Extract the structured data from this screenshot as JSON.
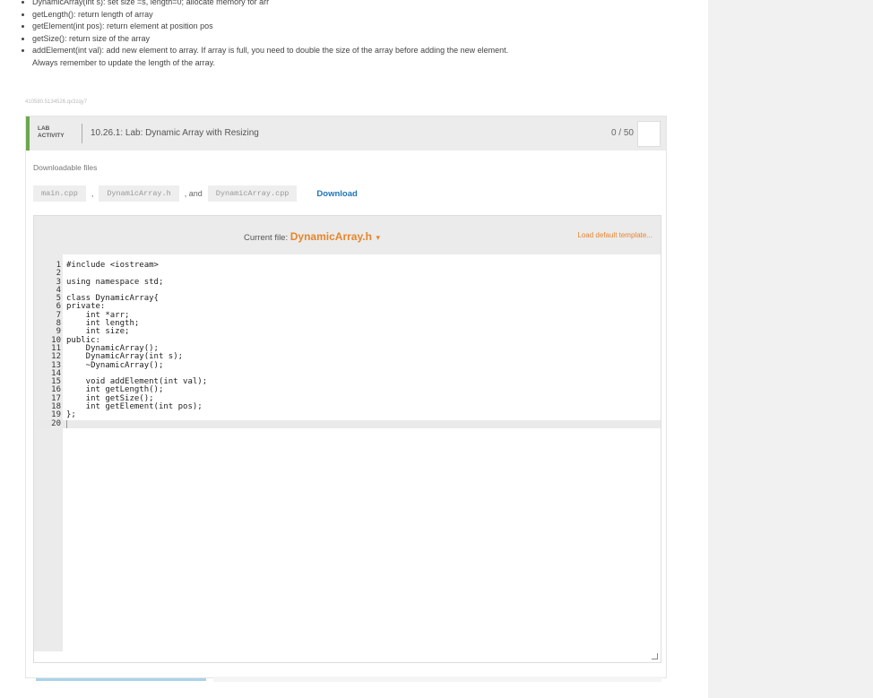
{
  "instructions": {
    "bullets": [
      "DynamicArray(int s): set size =s, length=0; allocate memory for arr",
      "getLength(): return length of array",
      "getElement(int pos): return element at position pos",
      "getSize(): return size of the array",
      "addElement(int val): add new element to array. If array is full, you need to double the size of the array before adding the new element."
    ],
    "bullet_continuation": "Always remember to update the length of the array."
  },
  "activity_id": "410580.5134526.qx3zqy7",
  "lab": {
    "tag_line1": "LAB",
    "tag_line2": "ACTIVITY",
    "title": "10.26.1: Lab: Dynamic Array with Resizing",
    "score": "0 / 50"
  },
  "downloads": {
    "label": "Downloadable files",
    "files": [
      "main.cpp",
      "DynamicArray.h",
      "DynamicArray.cpp"
    ],
    "sep1": ",",
    "sep2": ", and",
    "download_label": "Download"
  },
  "editor": {
    "current_file_label": "Current file:",
    "current_file": "DynamicArray.h",
    "caret": "▾",
    "load_template": "Load default template...",
    "lines": [
      "#include <iostream>",
      "",
      "using namespace std;",
      "",
      "class DynamicArray{",
      "private:",
      "    int *arr;",
      "    int length;",
      "    int size;",
      "public:",
      "    DynamicArray();",
      "    DynamicArray(int s);",
      "    ~DynamicArray();",
      "",
      "    void addElement(int val);",
      "    int getLength();",
      "    int getSize();",
      "    int getElement(int pos);",
      "};",
      ""
    ],
    "active_line": 20
  },
  "colors": {
    "accent_orange": "#e8852b",
    "link_blue": "#1f74b8",
    "lab_green": "#6aa84f"
  }
}
